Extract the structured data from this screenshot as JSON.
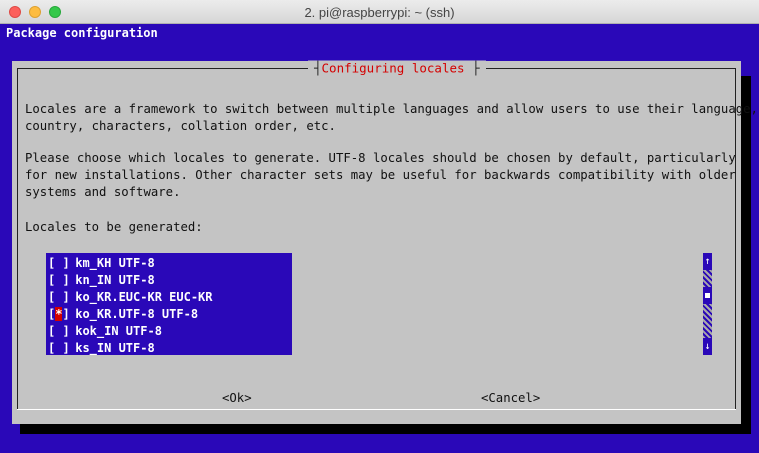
{
  "window": {
    "title": "2. pi@raspberrypi: ~ (ssh)"
  },
  "terminal": {
    "header": "Package configuration"
  },
  "dialog": {
    "title": "Configuring locales",
    "paragraph1": "Locales are a framework to switch between multiple languages and allow users to use their language,\ncountry, characters, collation order, etc.",
    "paragraph2": "Please choose which locales to generate. UTF-8 locales should be chosen by default, particularly\nfor new installations. Other character sets may be useful for backwards compatibility with older\nsystems and software.",
    "list_label": "Locales to be generated:",
    "locales": [
      {
        "checkbox": "[ ]",
        "label": "km_KH UTF-8",
        "checked": false
      },
      {
        "checkbox": "[ ]",
        "label": "kn_IN UTF-8",
        "checked": false
      },
      {
        "checkbox": "[ ]",
        "label": "ko_KR.EUC-KR EUC-KR",
        "checked": false
      },
      {
        "checkbox": "[*]",
        "label": "ko_KR.UTF-8 UTF-8",
        "checked": true
      },
      {
        "checkbox": "[ ]",
        "label": "kok_IN UTF-8",
        "checked": false
      },
      {
        "checkbox": "[ ]",
        "label": "ks_IN UTF-8",
        "checked": false
      }
    ],
    "scroll_up": "↑",
    "scroll_down": "↓",
    "ok_label": "<Ok>",
    "cancel_label": "<Cancel>"
  },
  "colors": {
    "terminal_bg": "#2a08b8",
    "dialog_bg": "#c4c4c4",
    "title_red": "#d40000"
  }
}
